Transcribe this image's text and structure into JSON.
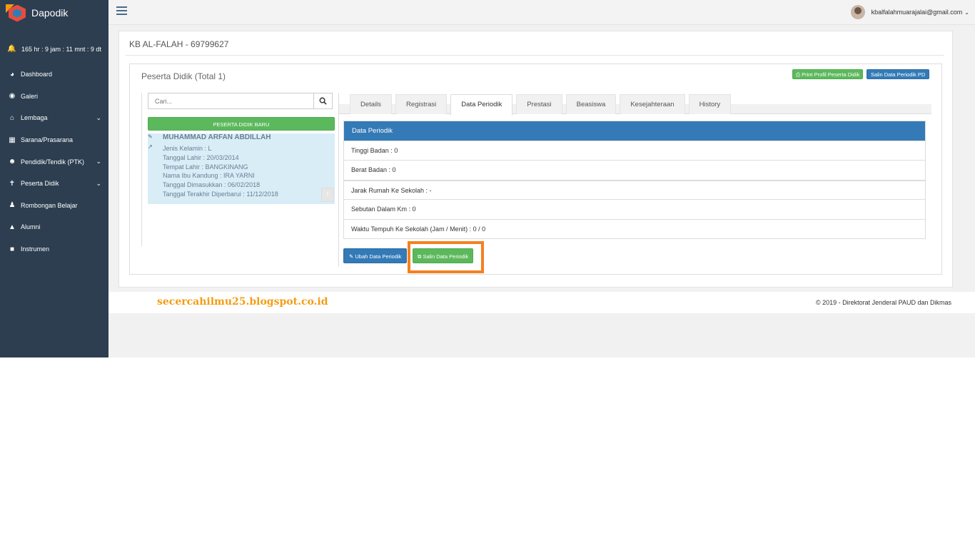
{
  "brand": {
    "name": "Dapodik"
  },
  "timer": {
    "text": "165 hr : 9 jam : 11 mnt : 9 dt"
  },
  "sidebar": {
    "items": [
      {
        "label": "Dashboard",
        "icon": "dashboard-icon",
        "chevron": false
      },
      {
        "label": "Galeri",
        "icon": "camera-icon",
        "chevron": false
      },
      {
        "label": "Lembaga",
        "icon": "home-icon",
        "chevron": true
      },
      {
        "label": "Sarana/Prasarana",
        "icon": "building-icon",
        "chevron": false
      },
      {
        "label": "Pendidik/Tendik (PTK)",
        "icon": "user-icon",
        "chevron": true
      },
      {
        "label": "Peserta Didik",
        "icon": "child-icon",
        "chevron": true
      },
      {
        "label": "Rombongan Belajar",
        "icon": "users-icon",
        "chevron": false
      },
      {
        "label": "Alumni",
        "icon": "graduation-cap-icon",
        "chevron": false
      },
      {
        "label": "Instrumen",
        "icon": "folder-icon",
        "chevron": false
      }
    ]
  },
  "header": {
    "user_email": "kbalfalahmuarajalai@gmail.com"
  },
  "school": {
    "title": "KB AL-FALAH - 69799627"
  },
  "panel": {
    "title": "Peserta Didik (Total 1)",
    "print_label": "Print Profil Peserta Didik",
    "salin_pd_label": "Salin Data Periodik PD"
  },
  "search": {
    "placeholder": "Cari..."
  },
  "new_student_label": "PESERTA DIDIK BARU",
  "student": {
    "name": "MUHAMMAD ARFAN ABDILLAH",
    "details": [
      "Jenis Kelamin : L",
      "Tanggal Lahir : 20/03/2014",
      "Tempat Lahir : BANGKINANG",
      "Nama Ibu Kandung : IRA YARNI",
      "Tanggal Dimasukkan : 06/02/2018",
      "Tanggal Terakhir Diperbarui : 11/12/2018"
    ]
  },
  "pager": {
    "page": "1"
  },
  "tabs": [
    "Details",
    "Registrasi",
    "Data Periodik",
    "Prestasi",
    "Beasiswa",
    "Kesejahteraan",
    "History"
  ],
  "active_tab": "Data Periodik",
  "data_periodik": {
    "heading": "Data Periodik",
    "rows": [
      "Tinggi Badan : 0",
      "Berat Badan : 0",
      "Jarak Rumah Ke Sekolah : -",
      "Sebutan Dalam Km : 0",
      "Waktu Tempuh Ke Sekolah (Jam / Menit) : 0 / 0"
    ],
    "edit_label": "Ubah Data Periodik",
    "copy_label": "Salin Data Periodik"
  },
  "footer": {
    "blog": "secercahilmu25.blogspot.co.id",
    "copyright": "© 2019 - Direktorat Jenderal PAUD dan Dikmas"
  },
  "colors": {
    "sidebar": "#2c3e50",
    "primary": "#337ab7",
    "success": "#5cb85c",
    "highlight": "#f4801f",
    "row_selected": "#d9edf7"
  }
}
